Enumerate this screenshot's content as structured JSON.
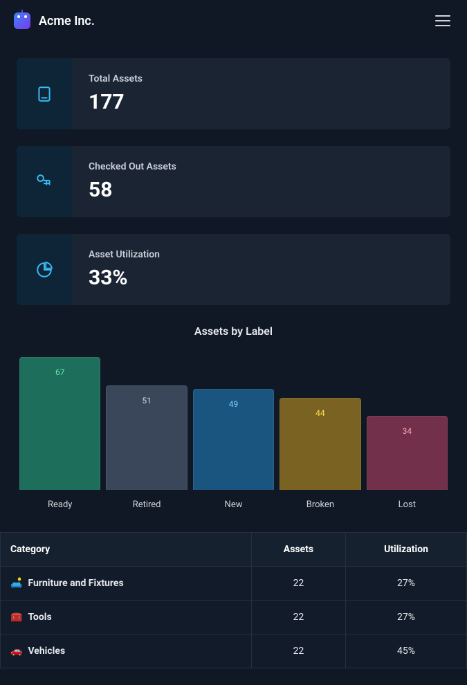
{
  "brand": {
    "name": "Acme Inc."
  },
  "stats": [
    {
      "label": "Total Assets",
      "value": "177",
      "icon": "storage-icon"
    },
    {
      "label": "Checked Out Assets",
      "value": "58",
      "icon": "tag-icon"
    },
    {
      "label": "Asset Utilization",
      "value": "33%",
      "icon": "pie-icon"
    }
  ],
  "chart_data": {
    "type": "bar",
    "title": "Assets by Label",
    "categories": [
      "Ready",
      "Retired",
      "New",
      "Broken",
      "Lost"
    ],
    "values": [
      67,
      51,
      49,
      44,
      34
    ],
    "colors": [
      "#1d6e5a",
      "#3a465a",
      "#1a5580",
      "#7a6322",
      "#72304a"
    ],
    "text_colors": [
      "#6ee7b7",
      "#cbd5e1",
      "#7dd3fc",
      "#fde047",
      "#fda4af"
    ],
    "ylim": [
      0,
      70
    ]
  },
  "table": {
    "headers": [
      "Category",
      "Assets",
      "Utilization"
    ],
    "rows": [
      {
        "icon": "🛋️",
        "name": "Furniture and Fixtures",
        "assets": "22",
        "utilization": "27%"
      },
      {
        "icon": "🧰",
        "name": "Tools",
        "assets": "22",
        "utilization": "27%"
      },
      {
        "icon": "🚗",
        "name": "Vehicles",
        "assets": "22",
        "utilization": "45%"
      }
    ]
  }
}
